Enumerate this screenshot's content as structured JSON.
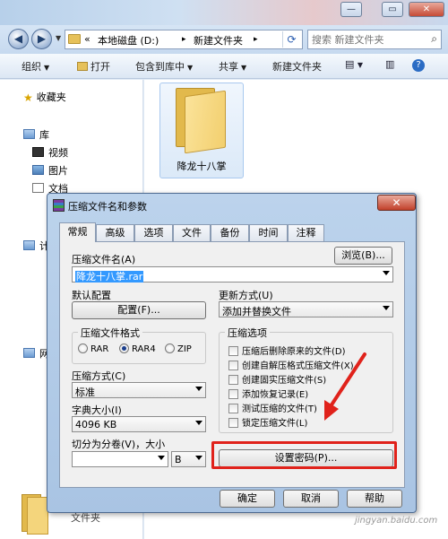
{
  "explorer": {
    "caption_buttons": {
      "minimize": "—",
      "maximize": "▭",
      "close": "✕"
    },
    "breadcrumb": [
      "«",
      "本地磁盘 (D:)",
      "▸",
      "新建文件夹",
      "▸"
    ],
    "search_placeholder": "搜索 新建文件夹",
    "toolbar": {
      "organize": "组织",
      "open": "打开",
      "include_in_library": "包含到库中",
      "share": "共享",
      "new_folder": "新建文件夹"
    },
    "nav": {
      "favorites": "收藏夹",
      "libraries": "库",
      "videos": "视频",
      "pictures": "图片",
      "documents": "文档",
      "computer_partial": "计",
      "network_partial": "网"
    },
    "selected_folder_name": "降龙十八掌",
    "bottom_folder_name": "文件夹"
  },
  "dialog": {
    "title": "压缩文件名和参数",
    "close_glyph": "✕",
    "tabs": [
      "常规",
      "高级",
      "选项",
      "文件",
      "备份",
      "时间",
      "注释"
    ],
    "active_tab": "常规",
    "archive_name_label": "压缩文件名(A)",
    "browse_button": "浏览(B)...",
    "archive_name_value": "降龙十八掌.rar",
    "default_profile_label": "默认配置",
    "profile_button": "配置(F)...",
    "update_mode_label": "更新方式(U)",
    "update_mode_value": "添加并替换文件",
    "format_group_title": "压缩文件格式",
    "formats": [
      {
        "label": "RAR",
        "selected": false
      },
      {
        "label": "RAR4",
        "selected": true
      },
      {
        "label": "ZIP",
        "selected": false
      }
    ],
    "options_group_title": "压缩选项",
    "options": [
      "压缩后删除原来的文件(D)",
      "创建自解压格式压缩文件(X)",
      "创建固实压缩文件(S)",
      "添加恢复记录(E)",
      "测试压缩的文件(T)",
      "锁定压缩文件(L)"
    ],
    "method_label": "压缩方式(C)",
    "method_value": "标准",
    "dict_label": "字典大小(I)",
    "dict_value": "4096 KB",
    "split_label": "切分为分卷(V)，大小",
    "split_value": "",
    "split_unit": "B",
    "set_password_button": "设置密码(P)...",
    "ok_button": "确定",
    "cancel_button": "取消",
    "help_button": "帮助"
  },
  "annotation": {
    "highlight_color": "#e0221b"
  },
  "watermark": "jingyan.baidu.com"
}
